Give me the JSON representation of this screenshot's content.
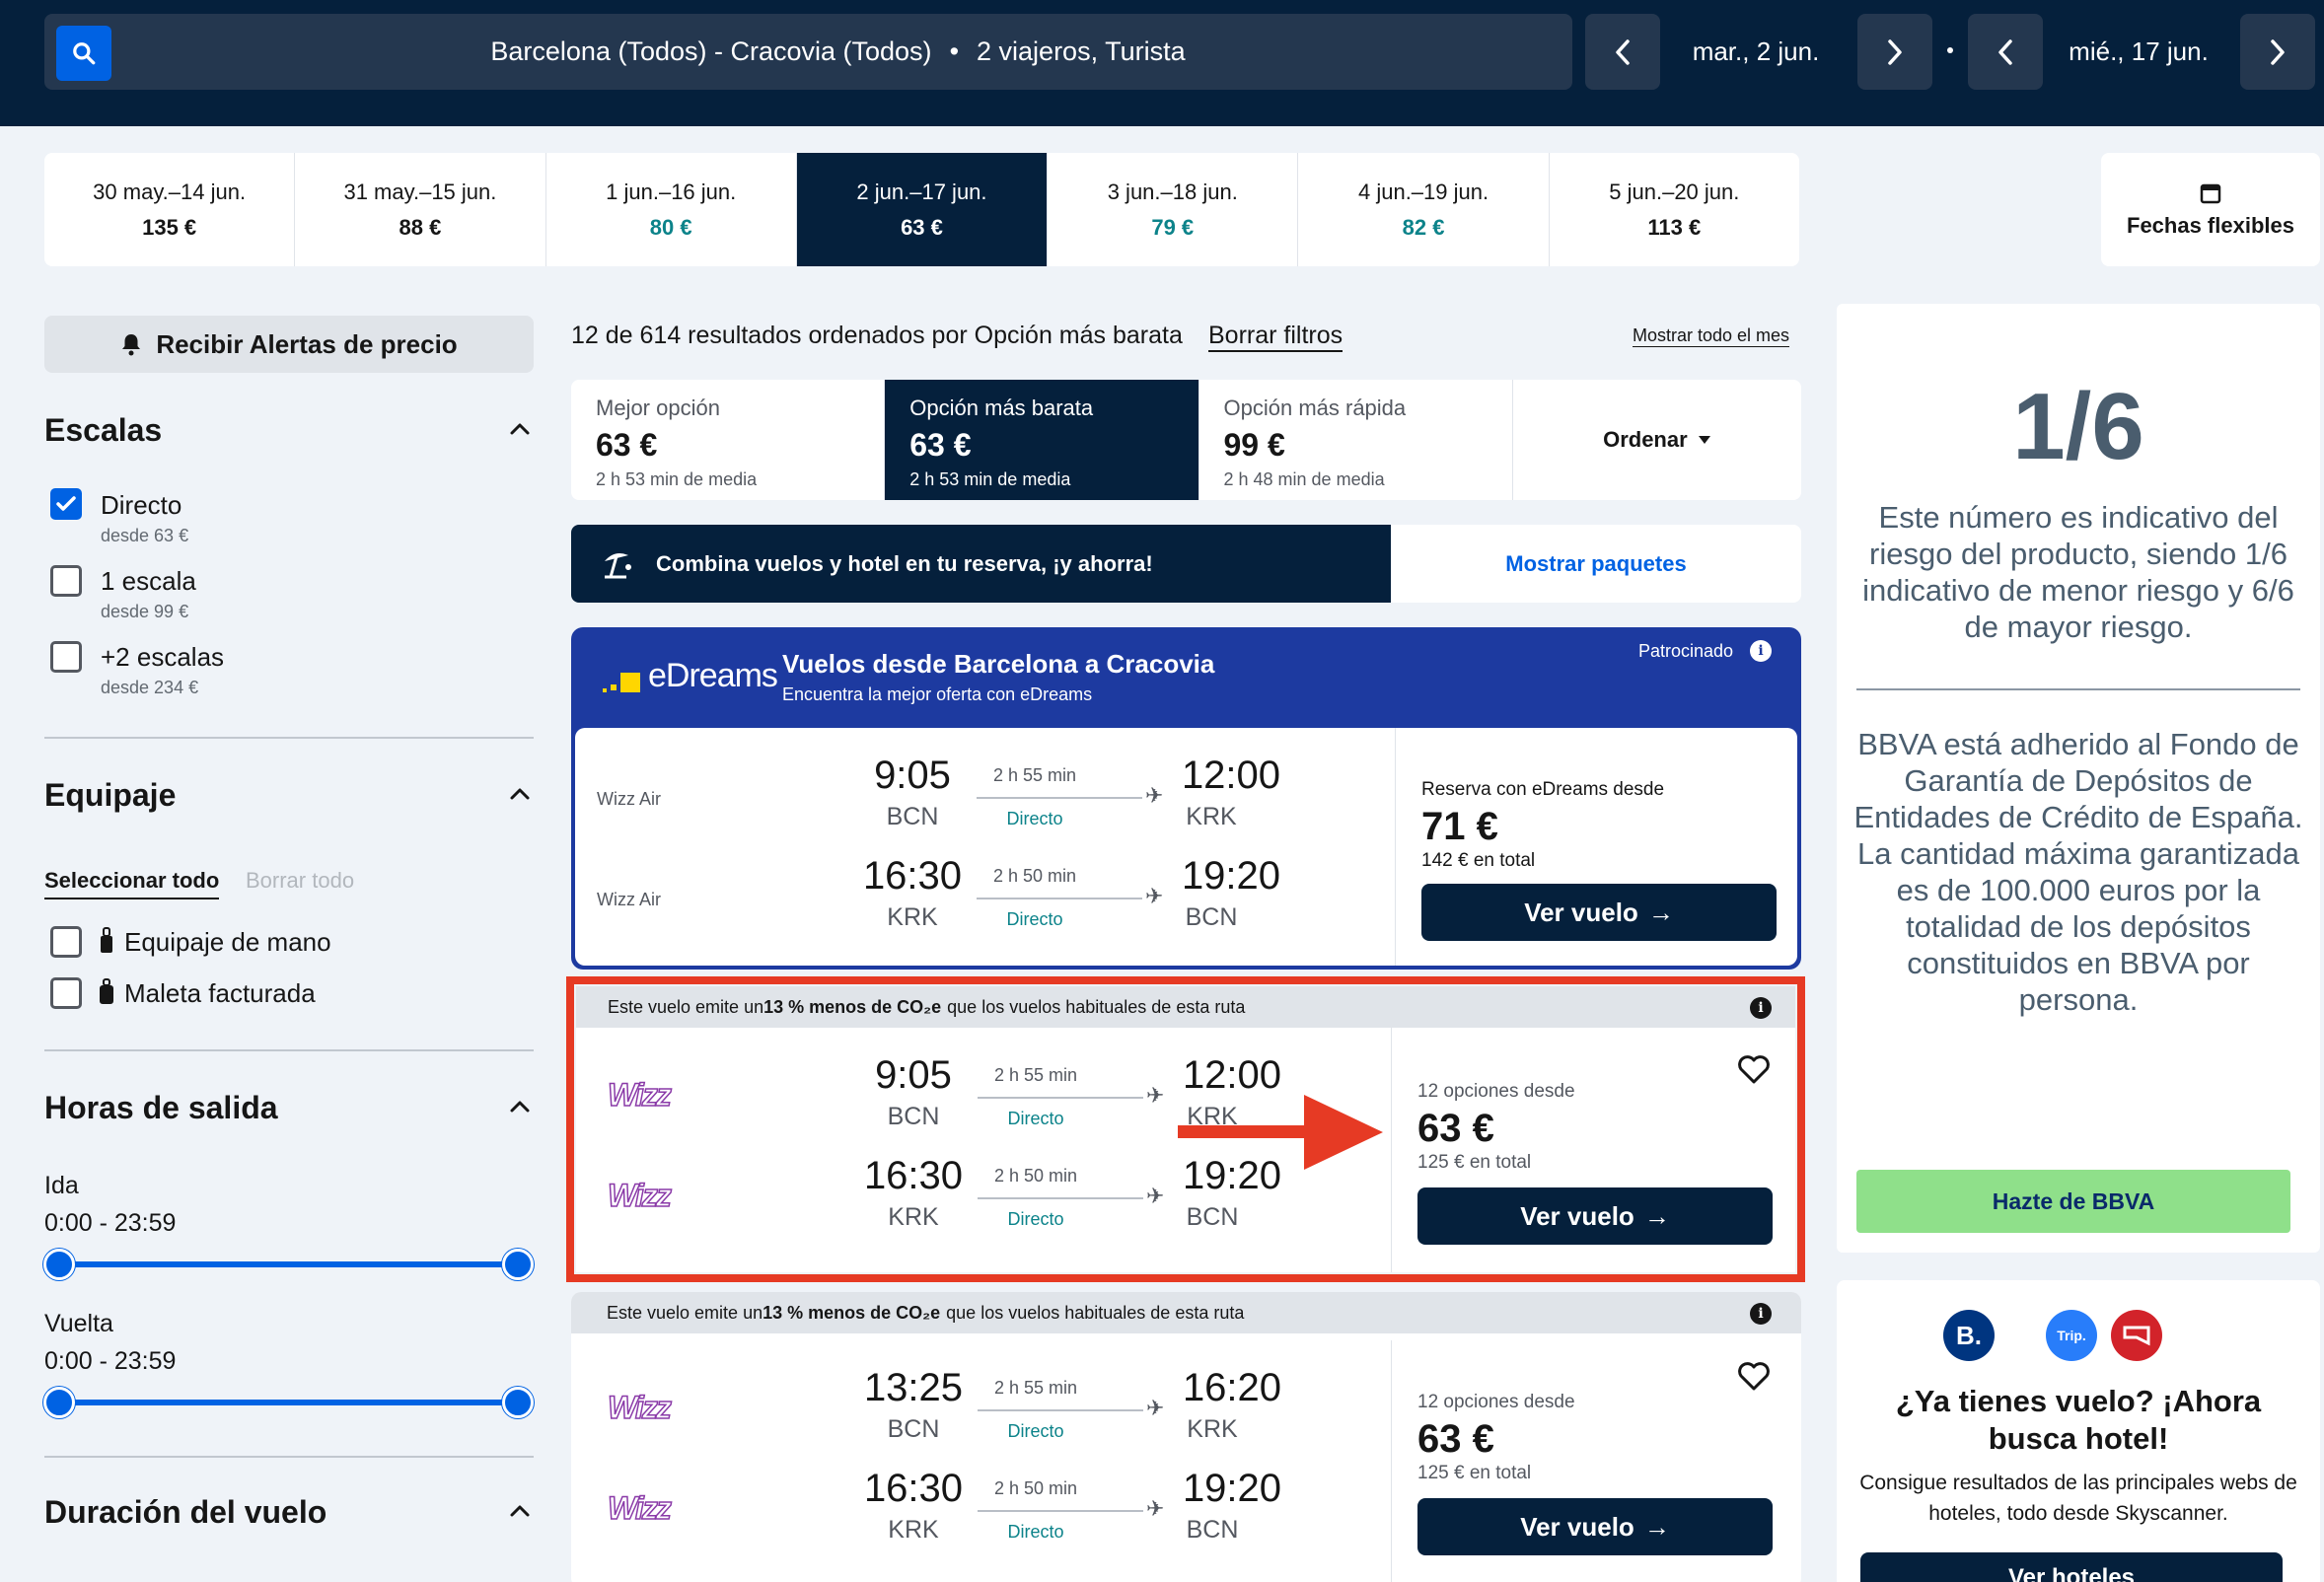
{
  "search": {
    "route": "Barcelona (Todos) - Cracovia (Todos)",
    "travelers": "2 viajeros, Turista",
    "date_out": "mar., 2 jun.",
    "date_back": "mié., 17 jun."
  },
  "date_strip": [
    {
      "dates": "30 may.–14 jun.",
      "price": "135 €",
      "green": false,
      "selected": false
    },
    {
      "dates": "31 may.–15 jun.",
      "price": "88 €",
      "green": false,
      "selected": false
    },
    {
      "dates": "1 jun.–16 jun.",
      "price": "80 €",
      "green": true,
      "selected": false
    },
    {
      "dates": "2 jun.–17 jun.",
      "price": "63 €",
      "green": false,
      "selected": true
    },
    {
      "dates": "3 jun.–18 jun.",
      "price": "79 €",
      "green": true,
      "selected": false
    },
    {
      "dates": "4 jun.–19 jun.",
      "price": "82 €",
      "green": true,
      "selected": false
    },
    {
      "dates": "5 jun.–20 jun.",
      "price": "113 €",
      "green": false,
      "selected": false
    }
  ],
  "flex_dates": "Fechas flexibles",
  "sidebar": {
    "alerts": "Recibir Alertas de precio",
    "stops": {
      "title": "Escalas",
      "options": [
        {
          "label": "Directo",
          "sub": "desde 63 €",
          "checked": true
        },
        {
          "label": "1 escala",
          "sub": "desde 99 €",
          "checked": false
        },
        {
          "label": "+2 escalas",
          "sub": "desde 234 €",
          "checked": false
        }
      ]
    },
    "baggage": {
      "title": "Equipaje",
      "select_all": "Seleccionar todo",
      "clear_all": "Borrar todo",
      "options": [
        "Equipaje de mano",
        "Maleta facturada"
      ]
    },
    "times": {
      "title": "Horas de salida",
      "out_label": "Ida",
      "out_range": "0:00 - 23:59",
      "back_label": "Vuelta",
      "back_range": "0:00 - 23:59"
    },
    "duration": {
      "title": "Duración del vuelo"
    }
  },
  "results": {
    "summary": "12 de 614 resultados ordenados por Opción más barata",
    "clear_filters": "Borrar filtros",
    "show_month": "Mostrar todo el mes"
  },
  "sort_tabs": [
    {
      "label": "Mejor opción",
      "price": "63 €",
      "sub": "2 h 53 min de media"
    },
    {
      "label": "Opción más barata",
      "price": "63 €",
      "sub": "2 h 53 min de media"
    },
    {
      "label": "Opción más rápida",
      "price": "99 €",
      "sub": "2 h 48 min de media"
    }
  ],
  "order_label": "Ordenar",
  "combo": {
    "text": "Combina vuelos y hotel en tu reserva, ¡y ahorra!",
    "button": "Mostrar paquetes"
  },
  "edreams": {
    "brand": "eDreams",
    "title": "Vuelos desde Barcelona a Cracovia",
    "subtitle": "Encuentra la mejor oferta con eDreams",
    "sponsored": "Patrocinado",
    "from_label": "Reserva con eDreams desde",
    "price": "71 €",
    "total": "142 € en total",
    "button": "Ver vuelo",
    "legs": [
      {
        "airline": "Wizz Air",
        "dep": "9:05",
        "dep_code": "BCN",
        "dur": "2 h 55 min",
        "stops": "Directo",
        "arr": "12:00",
        "arr_code": "KRK"
      },
      {
        "airline": "Wizz Air",
        "dep": "16:30",
        "dep_code": "KRK",
        "dur": "2 h 50 min",
        "stops": "Directo",
        "arr": "19:20",
        "arr_code": "BCN"
      }
    ]
  },
  "eco": {
    "pre": "Este vuelo emite un ",
    "bold": "13 % menos de CO₂e",
    "post": " que los vuelos habituales de esta ruta"
  },
  "flights": [
    {
      "options": "12 opciones desde",
      "price": "63 €",
      "total": "125 € en total",
      "button": "Ver vuelo",
      "logo": "Wizz",
      "legs": [
        {
          "dep": "9:05",
          "dep_code": "BCN",
          "dur": "2 h 55 min",
          "stops": "Directo",
          "arr": "12:00",
          "arr_code": "KRK"
        },
        {
          "dep": "16:30",
          "dep_code": "KRK",
          "dur": "2 h 50 min",
          "stops": "Directo",
          "arr": "19:20",
          "arr_code": "BCN"
        }
      ]
    },
    {
      "options": "12 opciones desde",
      "price": "63 €",
      "total": "125 € en total",
      "button": "Ver vuelo",
      "logo": "Wizz",
      "legs": [
        {
          "dep": "13:25",
          "dep_code": "BCN",
          "dur": "2 h 55 min",
          "stops": "Directo",
          "arr": "16:20",
          "arr_code": "KRK"
        },
        {
          "dep": "16:30",
          "dep_code": "KRK",
          "dur": "2 h 50 min",
          "stops": "Directo",
          "arr": "19:20",
          "arr_code": "BCN"
        }
      ]
    }
  ],
  "bbva": {
    "risk": "1/6",
    "risk_text": "Este número es indicativo del riesgo del producto, siendo 1/6 indicativo de menor riesgo y 6/6 de mayor riesgo.",
    "fund_text": "BBVA está adherido al Fondo de Garantía de Depósitos de Entidades de Crédito de España. La cantidad máxima garantizada es de 100.000 euros por la totalidad de los depósitos constituidos en BBVA por persona.",
    "button": "Hazte de BBVA"
  },
  "hotel": {
    "logo_b": "B.",
    "logo_trip": "Trip.",
    "title": "¿Ya tienes vuelo? ¡Ahora busca hotel!",
    "text": "Consigue resultados de las principales webs de hoteles, todo desde Skyscanner.",
    "button": "Ver hoteles"
  },
  "colors": {
    "navy": "#05203c",
    "blue": "#0062e3",
    "green_price": "#0c838a",
    "edreams_blue": "#1d3aa0",
    "highlight": "#e63a24",
    "bbva_green": "#8fe08a"
  }
}
